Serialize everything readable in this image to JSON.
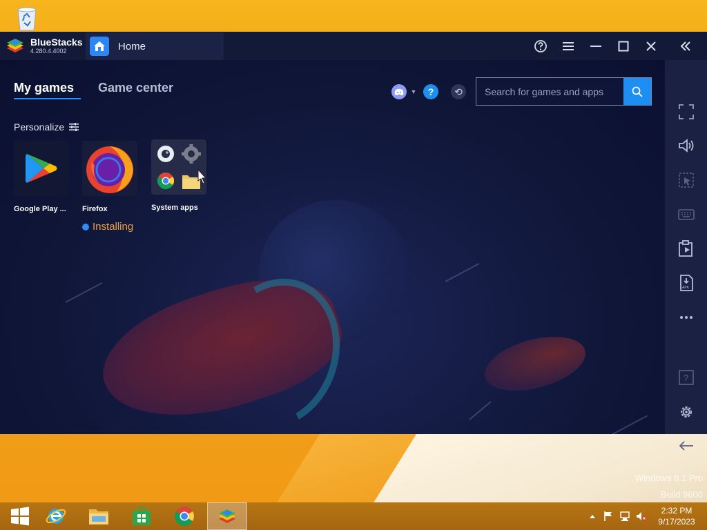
{
  "desktop": {
    "os_edition": "Windows 8.1 Pro",
    "build": "Build 9600"
  },
  "app": {
    "name": "BlueStacks",
    "version": "4.280.4.4002"
  },
  "tab": {
    "label": "Home"
  },
  "nav": {
    "my_games": "My games",
    "game_center": "Game center"
  },
  "personalize_label": "Personalize",
  "search": {
    "placeholder": "Search for games and apps"
  },
  "apps": [
    {
      "name": "Google Play ...",
      "status": ""
    },
    {
      "name": "Firefox",
      "status": "Installing"
    },
    {
      "name": "System apps",
      "status": ""
    }
  ],
  "sidebar_icons": [
    "fullscreen-icon",
    "volume-icon",
    "controls-icon",
    "keyboard-icon",
    "multi-instance-icon",
    "install-apk-icon",
    "more-icon",
    "help-icon",
    "settings-icon",
    "back-icon"
  ],
  "taskbar": {
    "time": "2:32 PM",
    "date": "9/17/2023"
  },
  "colors": {
    "accent": "#1d8ff3",
    "installing": "#f2a03a",
    "window_bg": "#0c1230"
  }
}
